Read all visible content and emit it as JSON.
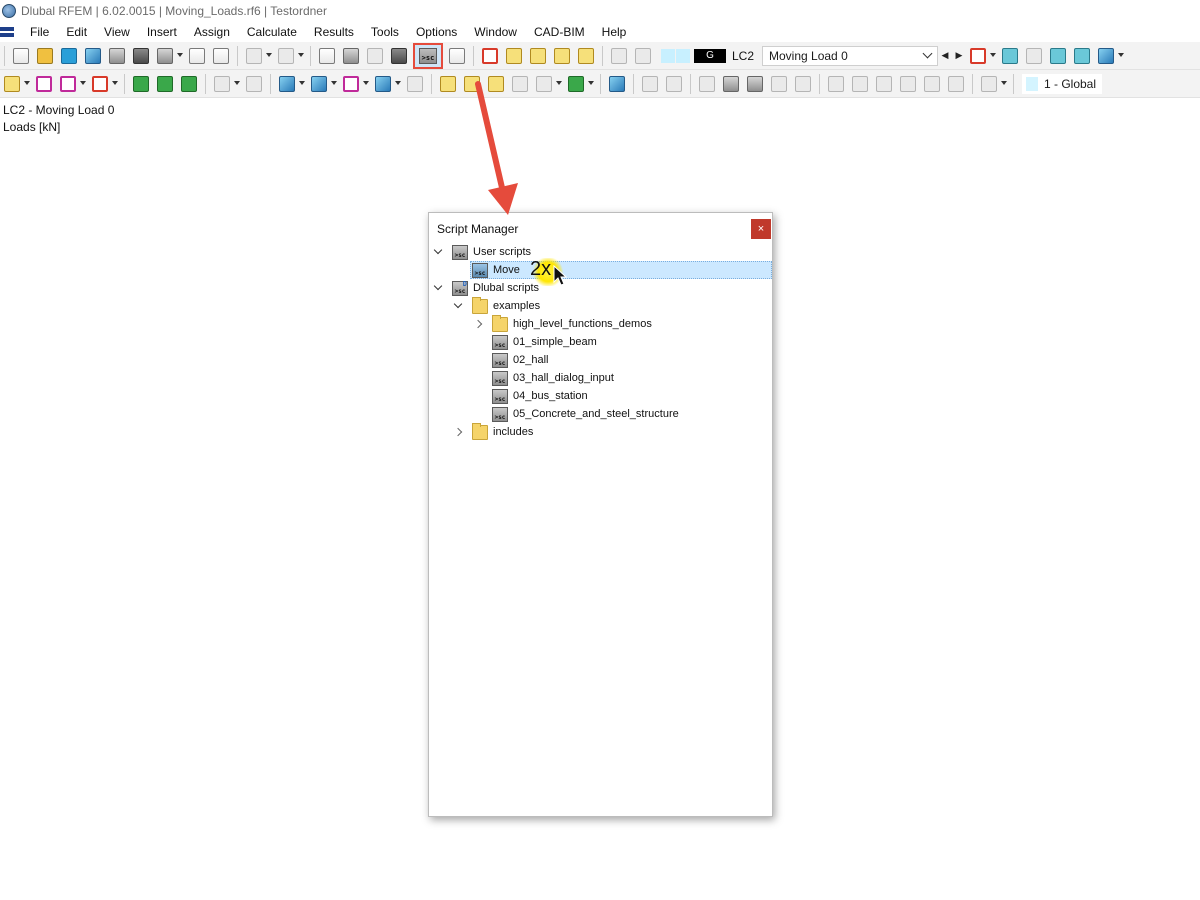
{
  "window": {
    "title": "Dlubal RFEM | 6.02.0015 | Moving_Loads.rf6 | Testordner"
  },
  "menu": {
    "items": [
      "File",
      "Edit",
      "View",
      "Insert",
      "Assign",
      "Calculate",
      "Results",
      "Tools",
      "Options",
      "Window",
      "CAD-BIM",
      "Help"
    ]
  },
  "toolbar": {
    "script_icon_text": ">sc",
    "load_case_color": "#c8f0ff",
    "load_case_type": "G",
    "load_case_code": "LC2",
    "load_case_name": "Moving Load 0",
    "coordinate_system": "1 - Global"
  },
  "info": {
    "line1": "LC2 - Moving Load 0",
    "line2": "Loads [kN]"
  },
  "script_manager": {
    "title": "Script Manager",
    "close_label": "×",
    "annotation": "2x",
    "tree": {
      "user_scripts": "User scripts",
      "move": "Move",
      "dlubal_scripts": "Dlubal scripts",
      "examples": "examples",
      "high_level": "high_level_functions_demos",
      "ex1": "01_simple_beam",
      "ex2": "02_hall",
      "ex3": "03_hall_dialog_input",
      "ex4": "04_bus_station",
      "ex5": "05_Concrete_and_steel_structure",
      "includes": "includes"
    }
  },
  "colors": {
    "highlight_red": "#e54b3c",
    "selection_blue": "#cce8ff"
  }
}
